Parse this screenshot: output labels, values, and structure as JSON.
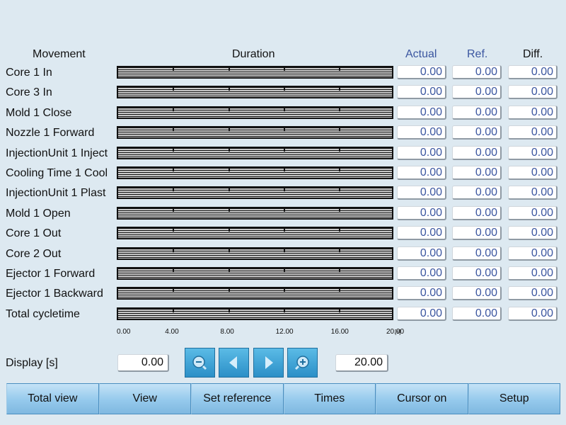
{
  "header": {
    "movement": "Movement",
    "duration": "Duration",
    "actual": "Actual",
    "ref": "Ref.",
    "diff": "Diff."
  },
  "rows": [
    {
      "label": "Core 1 In",
      "actual": "0.00",
      "ref": "0.00",
      "diff": "0.00"
    },
    {
      "label": "Core 3 In",
      "actual": "0.00",
      "ref": "0.00",
      "diff": "0.00"
    },
    {
      "label": "Mold 1 Close",
      "actual": "0.00",
      "ref": "0.00",
      "diff": "0.00"
    },
    {
      "label": "Nozzle 1 Forward",
      "actual": "0.00",
      "ref": "0.00",
      "diff": "0.00"
    },
    {
      "label": "InjectionUnit 1 Inject",
      "actual": "0.00",
      "ref": "0.00",
      "diff": "0.00"
    },
    {
      "label": "Cooling Time 1 Cool",
      "actual": "0.00",
      "ref": "0.00",
      "diff": "0.00"
    },
    {
      "label": "InjectionUnit 1 Plast",
      "actual": "0.00",
      "ref": "0.00",
      "diff": "0.00"
    },
    {
      "label": "Mold 1 Open",
      "actual": "0.00",
      "ref": "0.00",
      "diff": "0.00"
    },
    {
      "label": "Core 1 Out",
      "actual": "0.00",
      "ref": "0.00",
      "diff": "0.00"
    },
    {
      "label": "Core 2 Out",
      "actual": "0.00",
      "ref": "0.00",
      "diff": "0.00"
    },
    {
      "label": "Ejector 1 Forward",
      "actual": "0.00",
      "ref": "0.00",
      "diff": "0.00"
    },
    {
      "label": "Ejector 1 Backward",
      "actual": "0.00",
      "ref": "0.00",
      "diff": "0.00"
    },
    {
      "label": "Total cycletime",
      "actual": "0.00",
      "ref": "0.00",
      "diff": "0.00"
    }
  ],
  "axis": {
    "ticks": [
      "0.00",
      "4.00",
      "8.00",
      "12.00",
      "16.00",
      "20.00"
    ],
    "unit": "[s]"
  },
  "display": {
    "label": "Display [s]",
    "start": "0.00",
    "end": "20.00"
  },
  "nav_buttons": [
    {
      "name": "zoom-out-button",
      "icon": "zoom-out-icon"
    },
    {
      "name": "scroll-left-button",
      "icon": "arrow-left-icon"
    },
    {
      "name": "scroll-right-button",
      "icon": "arrow-right-icon"
    },
    {
      "name": "zoom-in-button",
      "icon": "zoom-in-icon"
    }
  ],
  "bottom_buttons": [
    "Total view",
    "View",
    "Set reference",
    "Times",
    "Cursor on",
    "Setup"
  ],
  "colors": {
    "background": "#dde9f1",
    "value_text": "#3b56a0",
    "button_blue": "#2b8fc7",
    "bottom_button": "#95c9ec"
  }
}
